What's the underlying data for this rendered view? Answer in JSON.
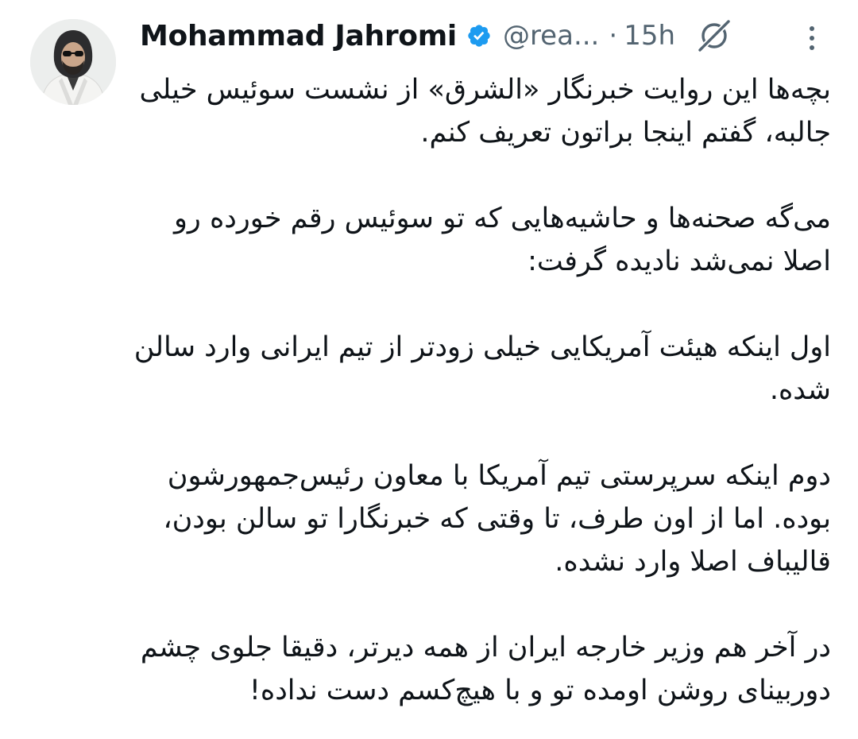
{
  "author": {
    "display_name": "Mohammad Jahromi",
    "handle": "@rea...",
    "separator": "·",
    "time": "15h",
    "verified": true,
    "verified_color": "#1d9bf0"
  },
  "icons": {
    "verified": "verified-badge-icon",
    "grok": "grok-icon",
    "more": "more-options-icon"
  },
  "tweet": {
    "paragraphs": [
      "بچه‌ها این روایت خبرنگار «الشرق» از نشست سوئیس خیلی جالبه، گفتم اینجا براتون تعریف کنم.",
      "می‌گه صحنه‌ها و حاشیه‌هایی که تو سوئیس رقم خورده رو اصلا نمی‌شد نادیده گرفت:",
      "اول اینکه هیئت آمریکایی خیلی زودتر از تیم ایرانی وارد سالن شده.",
      "دوم اینکه سرپرستی تیم آمریکا با معاون رئیس‌جمهورشون بوده. اما از اون طرف، تا وقتی که خبرنگارا تو سالن بودن، قالیباف اصلا وارد نشده.",
      "در آخر هم وزیر خارجه ایران از همه دیرتر، دقیقا جلوی چشم دوربینای روشن اومده تو و با هیچ‌کسم دست نداده!"
    ]
  }
}
